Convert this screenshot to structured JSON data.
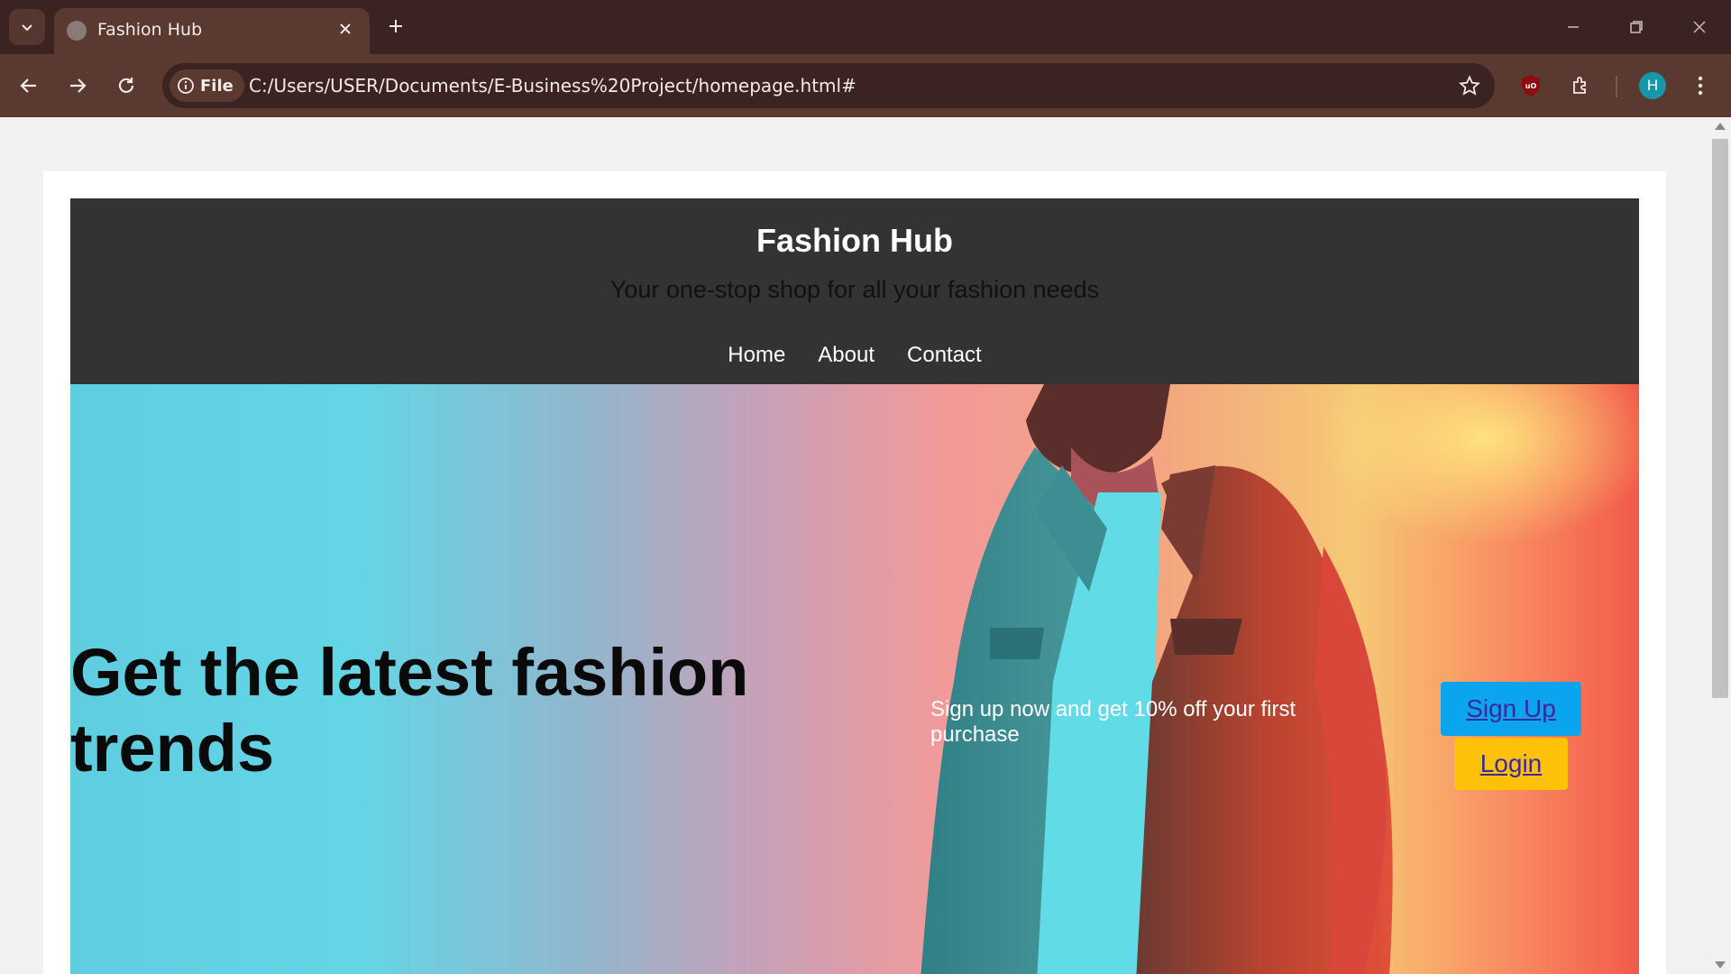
{
  "browser": {
    "tab_title": "Fashion Hub",
    "file_chip_label": "File",
    "url": "C:/Users/USER/Documents/E-Business%20Project/homepage.html#",
    "avatar_initial": "H",
    "extension_badge": "uO"
  },
  "site": {
    "title": "Fashion Hub",
    "tagline": "Your one-stop shop for all your fashion needs",
    "nav": [
      "Home",
      "About",
      "Contact"
    ]
  },
  "hero": {
    "heading": "Get the latest fashion trends",
    "offer_text": "Sign up now and get 10% off your first purchase",
    "signup_label": "Sign Up",
    "login_label": "Login"
  },
  "colors": {
    "chrome_dark": "#3a2320",
    "chrome_tab": "#5a3a30",
    "header_bg": "#333333",
    "signup_bg": "#0aa5ee",
    "login_bg": "#fdc10a"
  }
}
